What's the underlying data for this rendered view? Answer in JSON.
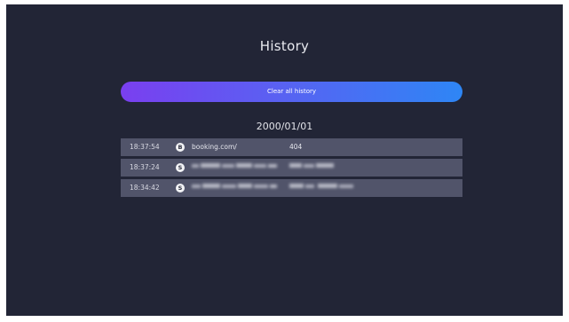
{
  "page": {
    "title": "History",
    "clear_label": "Clear all history",
    "date_group": "2000/01/01"
  },
  "history": [
    {
      "time": "18:37:54",
      "icon": "B",
      "icon_name": "booking-favicon-icon",
      "url": "booking.com/",
      "page_title": "404",
      "blurred": false
    },
    {
      "time": "18:37:24",
      "icon": "S",
      "icon_name": "site-favicon-icon",
      "url": "",
      "page_title": "",
      "blurred": true
    },
    {
      "time": "18:34:42",
      "icon": "S",
      "icon_name": "site-favicon-icon",
      "url": "",
      "page_title": "",
      "blurred": true
    }
  ],
  "colors": {
    "background": "#222536",
    "row": "#51546a",
    "button_gradient_start": "#7a3ff0",
    "button_gradient_end": "#2e86f5"
  }
}
